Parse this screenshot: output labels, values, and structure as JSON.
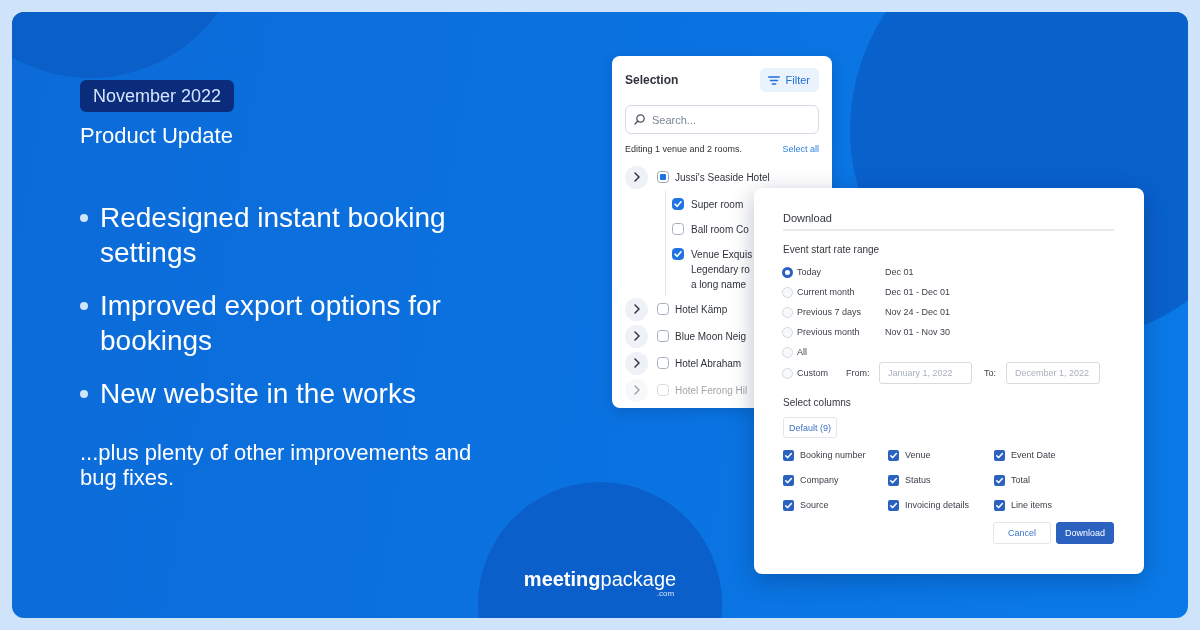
{
  "intro": {
    "badge": "November 2022",
    "subtitle": "Product Update",
    "bullets": [
      "Redesigned instant booking settings",
      "Improved export options for bookings",
      "New website in the works"
    ],
    "footnote": "...plus plenty of other improvements and bug fixes."
  },
  "selection_panel": {
    "title": "Selection",
    "filter_button": "Filter",
    "search": {
      "placeholder": "Search..."
    },
    "summary": "Editing 1 venue and 2 rooms.",
    "select_all": "Select all",
    "venues": [
      {
        "name": "Jussi's Seaside Hotel",
        "checked": false,
        "partial": true,
        "children": [
          {
            "lines": [
              "Super room"
            ],
            "checked": true
          },
          {
            "lines": [
              "Ball room Co"
            ],
            "checked": false
          },
          {
            "lines": [
              "Venue Exquis",
              "Legendary ro",
              "a long name"
            ],
            "checked": true
          }
        ]
      },
      {
        "name": "Hotel Kämp",
        "checked": false,
        "partial": false
      },
      {
        "name": "Blue Moon Neig",
        "checked": false,
        "partial": false
      },
      {
        "name": "Hotel Abraham",
        "checked": false,
        "partial": false
      },
      {
        "name": "Hotel Ferong Hil",
        "checked": false,
        "partial": false
      }
    ]
  },
  "download_panel": {
    "title": "Download",
    "range_label": "Event start rate range",
    "ranges": [
      {
        "kind": "preset",
        "label": "Today",
        "dates": "Dec 01",
        "selected": true
      },
      {
        "kind": "preset",
        "label": "Current month",
        "dates": "Dec 01 - Dec 01",
        "selected": false
      },
      {
        "kind": "preset",
        "label": "Previous 7 days",
        "dates": "Nov 24 - Dec 01",
        "selected": false
      },
      {
        "kind": "preset",
        "label": "Previous month",
        "dates": "Nov 01 - Nov 30",
        "selected": false
      },
      {
        "kind": "preset",
        "label": "All",
        "selected": false
      },
      {
        "kind": "custom",
        "label": "Custom",
        "selected": false,
        "from": {
          "label": "From:",
          "placeholder": "January 1, 2022"
        },
        "to": {
          "label": "To:",
          "placeholder": "December 1, 2022"
        }
      }
    ],
    "columns_label": "Select columns",
    "preset_button": "Default (9)",
    "columns": [
      {
        "label": "Booking number",
        "checked": true
      },
      {
        "label": "Venue",
        "checked": true
      },
      {
        "label": "Event Date",
        "checked": true
      },
      {
        "label": "Company",
        "checked": true
      },
      {
        "label": "Status",
        "checked": true
      },
      {
        "label": "Total",
        "checked": true
      },
      {
        "label": "Source",
        "checked": true
      },
      {
        "label": "Invoicing details",
        "checked": true
      },
      {
        "label": "Line items",
        "checked": true
      }
    ],
    "buttons": [
      {
        "label": "Cancel",
        "kind": "secondary"
      },
      {
        "label": "Download",
        "kind": "primary"
      }
    ]
  },
  "logo": {
    "wordmark": "**meeting**package",
    "suffix": ".com"
  }
}
